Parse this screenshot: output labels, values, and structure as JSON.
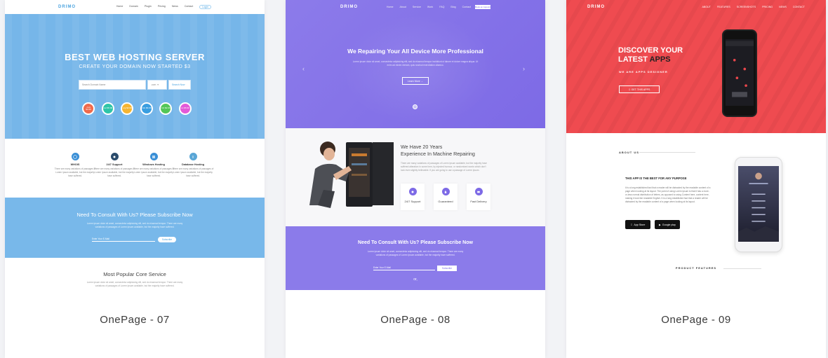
{
  "cards": [
    {
      "caption": "OnePage - 07",
      "logo": "DRIMO",
      "nav": [
        "Home",
        "Domain",
        "Plugin",
        "Pricing",
        "News",
        "Contact"
      ],
      "nav_button": "Login",
      "hero_title": "BEST WEB HOSTING SERVER",
      "hero_subtitle": "CREATE YOUR DOMAIN NOW STARTED $3",
      "search_placeholder": "Search Domain Name",
      "search_select": ".com",
      "search_button": "Search Now",
      "prices": [
        ".com $4.99",
        ".net $5.99",
        ".org $3.99",
        ".info $6.99",
        ".biz $2.99",
        ".co $5.99"
      ],
      "features": [
        {
          "title": "WHOIS",
          "text": "There are many variations of passages of Lorem Ipsum available, but the majority have suffered."
        },
        {
          "title": "24/7 Support",
          "text": "There are many variations of passages of Lorem Ipsum available, but the majority have suffered."
        },
        {
          "title": "Windows Hosting",
          "text": "There are many variations of passages of Lorem Ipsum available, but the majority have suffered."
        },
        {
          "title": "Database Hosting",
          "text": "There are many variations of passages of Lorem Ipsum available, but the majority have suffered."
        }
      ],
      "band_title": "Need To Consult With Us? Please Subscribe Now",
      "band_text": "Lorem ipsum dolor sit amet, consectetur adipisicing elit, sed do eiusmod tempor. There are many variations of passages of Lorem Ipsum available, but the majority have suffered.",
      "email_placeholder": "Enter Your E-Mail",
      "subscribe": "Subscribe",
      "section_title": "Most Popular Core Service",
      "section_text": "Lorem ipsum dolor sit amet, consectetur adipisicing elit, sed do eiusmod tempor. There are many variations of passages of Lorem Ipsum available, but the majority have suffered."
    },
    {
      "caption": "OnePage - 08",
      "logo": "DRIMO",
      "nav": [
        "Home",
        "About",
        "Service",
        "Work",
        "FAQ",
        "Blog",
        "Contact"
      ],
      "nav_button": "Book an Appoint",
      "hero_title": "We Repairing Your All Device More Professional",
      "hero_text": "Lorem ipsum dolor sit amet, consectetur adipisicing elit, sed do eiusmod tempor incididunt ut labore et dolore magna aliqua. Ut enim ad minim veniam, quis nostrud exercitation ullamco.",
      "hero_button": "Learn More",
      "about_title_1": "We Have  20 Years",
      "about_title_2": "Experience In Machine Repairing",
      "about_text": "There are many variations of passages of Lorem Ipsum available, but the majority have suffered alteration in some form, by injected humour, or randomised words which don't look even slightly believable. If you are going to use a passage of Lorem Ipsum.",
      "boxes": [
        "24/7 Support",
        "Guaranteed",
        "Fast Delivery"
      ],
      "band_title": "Need To Consult With Us? Please Subscribe Now",
      "band_text": "Lorem ipsum dolor sit amet, consectetur adipisicing elit, sed do eiusmod tempor. There are many variations of passages of Lorem Ipsum available, but the majority have suffered.",
      "email_placeholder": "Enter Your E-Mail",
      "subscribe": "Subscribe",
      "or": "or,"
    },
    {
      "caption": "OnePage - 09",
      "logo": "DRIMO",
      "nav": [
        "ABOUT",
        "FEATURES",
        "SCREENSHOTS",
        "PRICING",
        "NEWS",
        "CONTACT"
      ],
      "hero_title_1": "DISCOVER YOUR",
      "hero_title_2a": "LATEST ",
      "hero_title_2b": "APPS",
      "hero_sub": "WE ARE APPS DESIGNER",
      "hero_button": "GET THIS APPS",
      "about_label": "ABOUT US",
      "about_title": "THIS APP IS THE BEST FOR ANY PURPOSE",
      "about_text": "It is a long established fact that a reader will be distracted by the readable content of a page when looking at its layout. The point of using Lorem Ipsum is that it has a more-or-less normal distribution of letters, as opposed to using Content here, content here, making it look like readable English. It is a long established fact that a reader will be distracted by the readable content of a page when looking at its layout.",
      "store_1": "App Store",
      "store_2": "Google play",
      "features_label": "PRODUCT FEATURES"
    }
  ],
  "colors": {
    "blue": "#76b6e9",
    "purple": "#8b7bea",
    "red": "#ef4b50"
  }
}
